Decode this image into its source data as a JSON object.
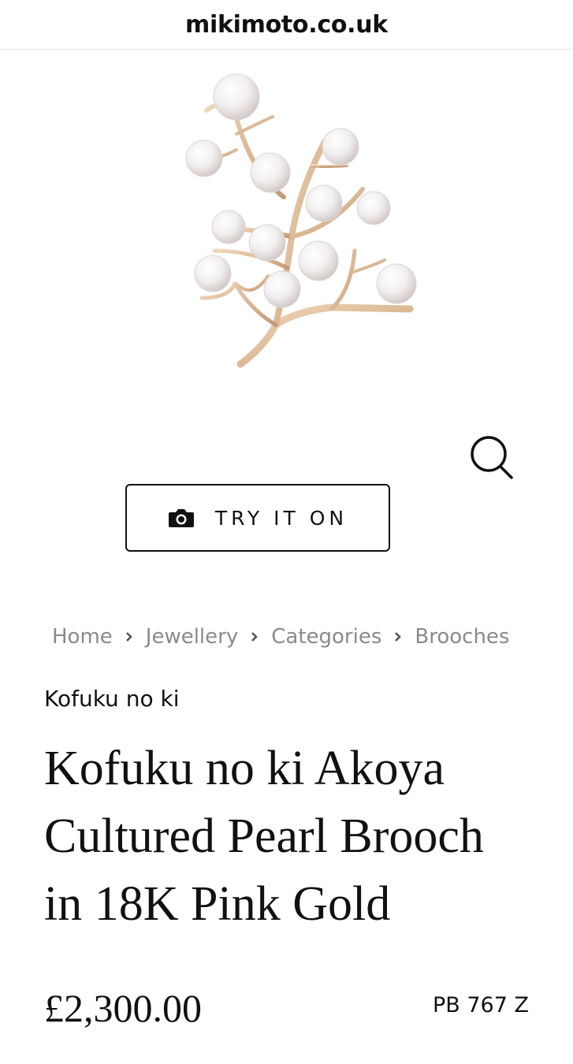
{
  "browser": {
    "url": "mikimoto.co.uk"
  },
  "try_on": {
    "label": "TRY IT ON",
    "icon": "camera-icon"
  },
  "zoom": {
    "icon": "search-icon"
  },
  "breadcrumb": [
    "Home",
    "Jewellery",
    "Categories",
    "Brooches"
  ],
  "product": {
    "collection": "Kofuku no ki",
    "title": "Kofuku no ki Akoya Cultured Pearl Brooch in 18K Pink Gold",
    "price": "£2,300.00",
    "sku": "PB 767 Z"
  },
  "colors": {
    "gold": "#d9b896",
    "pearl": "#f3f0ef",
    "text": "#111111",
    "muted": "#8a8a8a"
  }
}
